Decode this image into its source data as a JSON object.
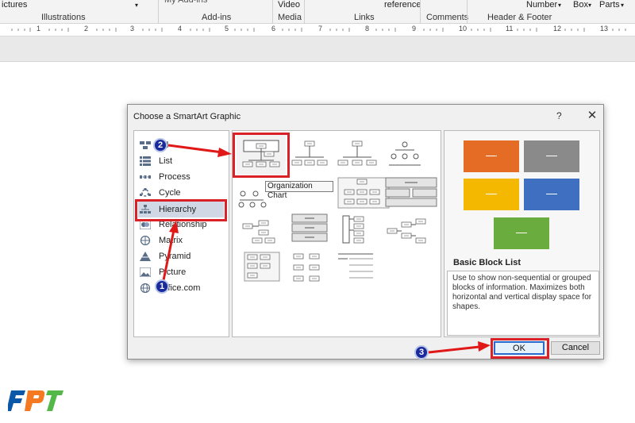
{
  "ribbon": {
    "top_labels": [
      "ictures",
      "My Add-ins",
      "Video",
      "reference",
      "Number",
      "Box",
      "Parts"
    ],
    "groups": [
      "Illustrations",
      "Add-ins",
      "Media",
      "Links",
      "Comments",
      "Header & Footer"
    ]
  },
  "ruler": [
    "1",
    "2",
    "3",
    "4",
    "5",
    "6",
    "7",
    "8",
    "9",
    "10",
    "11",
    "12",
    "13"
  ],
  "dialog": {
    "title": "Choose a SmartArt Graphic",
    "help": "?",
    "close": "✕",
    "categories": [
      {
        "label": "All",
        "icon": "all-icon"
      },
      {
        "label": "List",
        "icon": "list-icon"
      },
      {
        "label": "Process",
        "icon": "process-icon"
      },
      {
        "label": "Cycle",
        "icon": "cycle-icon"
      },
      {
        "label": "Hierarchy",
        "icon": "hierarchy-icon",
        "selected": true
      },
      {
        "label": "Relationship",
        "icon": "relationship-icon"
      },
      {
        "label": "Matrix",
        "icon": "matrix-icon"
      },
      {
        "label": "Pyramid",
        "icon": "pyramid-icon"
      },
      {
        "label": "Picture",
        "icon": "picture-icon"
      },
      {
        "label": "Office.com",
        "icon": "globe-icon"
      }
    ],
    "tooltip": "Organization Chart",
    "preview_colors": [
      "#e46c24",
      "#8a8a8a",
      "#f5b800",
      "#3f6fc1",
      "#6aad3e"
    ],
    "info_title": "Basic Block List",
    "info_desc": "Use to show non-sequential or grouped blocks of information. Maximizes both horizontal and vertical display space for shapes.",
    "ok": "OK",
    "cancel": "Cancel"
  },
  "badges": [
    "1",
    "2",
    "3"
  ],
  "logo": {
    "text": "FPT",
    "colors": [
      "#0b57a8",
      "#f47920",
      "#53b848"
    ]
  }
}
